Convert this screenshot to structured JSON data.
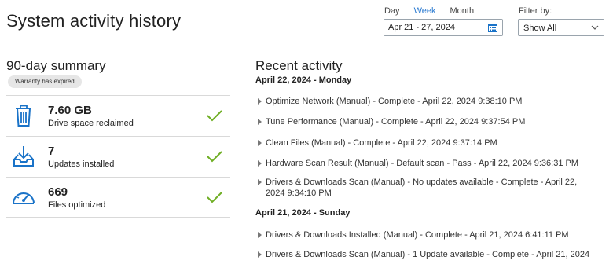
{
  "page": {
    "title": "System activity history"
  },
  "range": {
    "tabs": [
      {
        "label": "Day",
        "active": false
      },
      {
        "label": "Week",
        "active": true
      },
      {
        "label": "Month",
        "active": false
      }
    ],
    "date_value": "Apr 21 - 27, 2024",
    "date_icon": "calendar-icon"
  },
  "filter": {
    "label": "Filter by:",
    "value": "Show All",
    "icon": "chevron-down-icon"
  },
  "summary": {
    "title": "90-day summary",
    "badge": "Warranty has expired",
    "accent": "#1a73c8",
    "check_color": "#6fae24",
    "items": [
      {
        "value": "7.60 GB",
        "label": "Drive space reclaimed",
        "icon": "trash-icon"
      },
      {
        "value": "7",
        "label": "Updates installed",
        "icon": "download-tray-icon"
      },
      {
        "value": "669",
        "label": "Files optimized",
        "icon": "speedometer-icon"
      }
    ]
  },
  "recent": {
    "title": "Recent activity",
    "days": [
      {
        "heading": "April 22, 2024 - Monday",
        "items": [
          "Optimize Network (Manual) - Complete - April 22, 2024 9:38:10 PM",
          "Tune Performance (Manual) - Complete - April 22, 2024 9:37:54 PM",
          "Clean Files (Manual) - Complete - April 22, 2024 9:37:14 PM",
          "Hardware Scan Result (Manual) - Default scan - Pass - April 22, 2024 9:36:31 PM",
          "Drivers & Downloads Scan (Manual) - No updates available - Complete - April 22, 2024 9:34:10 PM"
        ]
      },
      {
        "heading": "April 21, 2024 - Sunday",
        "items": [
          "Drivers & Downloads Installed (Manual) - Complete - April 21, 2024 6:41:11 PM",
          "Drivers & Downloads Scan (Manual) - 1 Update available - Complete - April 21, 2024"
        ]
      }
    ]
  }
}
